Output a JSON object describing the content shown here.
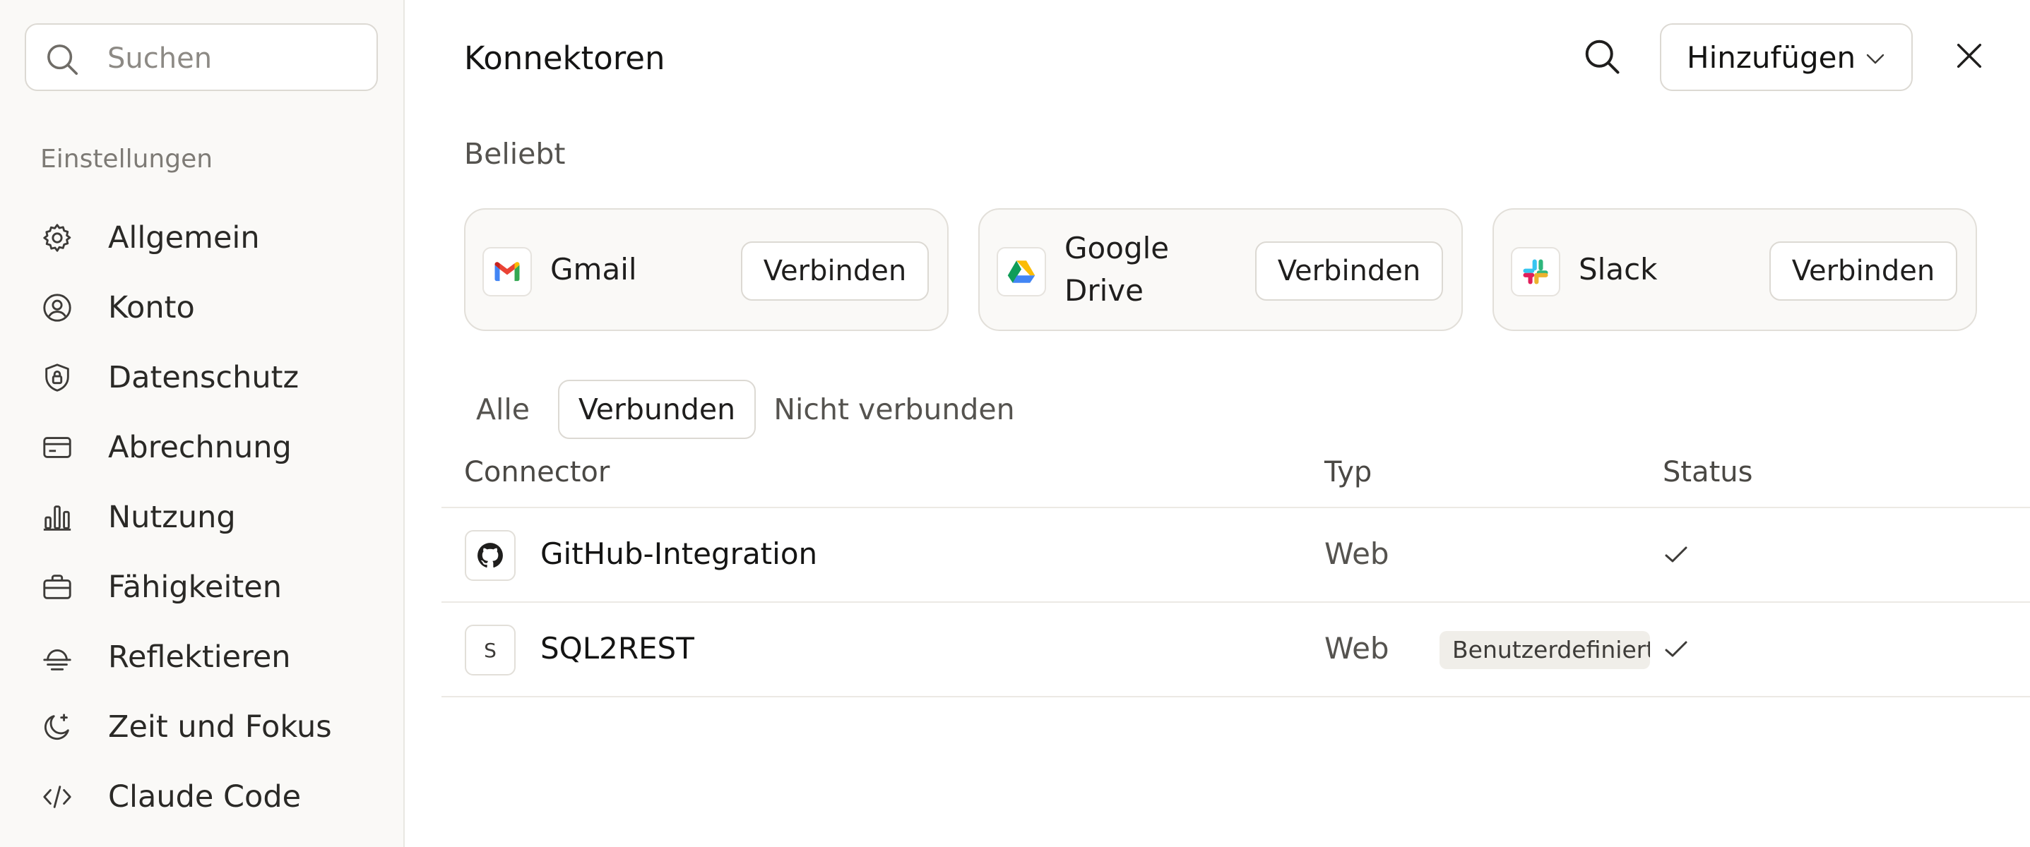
{
  "sidebar": {
    "search": {
      "placeholder": "Suchen",
      "icon": "search-icon"
    },
    "section_label": "Einstellungen",
    "items": [
      {
        "label": "Allgemein",
        "icon": "gear-icon"
      },
      {
        "label": "Konto",
        "icon": "user-circle-icon"
      },
      {
        "label": "Datenschutz",
        "icon": "shield-lock-icon"
      },
      {
        "label": "Abrechnung",
        "icon": "credit-card-icon"
      },
      {
        "label": "Nutzung",
        "icon": "bar-chart-icon"
      },
      {
        "label": "Fähigkeiten",
        "icon": "briefcase-icon"
      },
      {
        "label": "Reflektieren",
        "icon": "sunset-icon"
      },
      {
        "label": "Zeit und Fokus",
        "icon": "moon-sparkle-icon"
      },
      {
        "label": "Claude Code",
        "icon": "code-icon"
      }
    ]
  },
  "header": {
    "title": "Konnektoren",
    "add_button_label": "Hinzufügen"
  },
  "popular": {
    "label": "Beliebt",
    "cards": [
      {
        "name": "Gmail",
        "icon": "gmail-icon",
        "button_label": "Verbinden"
      },
      {
        "name": "Google Drive",
        "icon": "google-drive-icon",
        "button_label": "Verbinden"
      },
      {
        "name": "Slack",
        "icon": "slack-icon",
        "button_label": "Verbinden"
      }
    ]
  },
  "filters": [
    {
      "label": "Alle",
      "active": false
    },
    {
      "label": "Verbunden",
      "active": true
    },
    {
      "label": "Nicht verbunden",
      "active": false
    }
  ],
  "table": {
    "columns": [
      "Connector",
      "Typ",
      "Status"
    ],
    "rows": [
      {
        "icon": "github-icon",
        "logo_text": "",
        "name": "GitHub-Integration",
        "type": "Web",
        "badge": "",
        "status": "connected"
      },
      {
        "icon": "letter-s-icon",
        "logo_text": "S",
        "name": "SQL2REST",
        "type": "Web",
        "badge": "Benutzerdefiniert",
        "status": "connected"
      }
    ]
  }
}
